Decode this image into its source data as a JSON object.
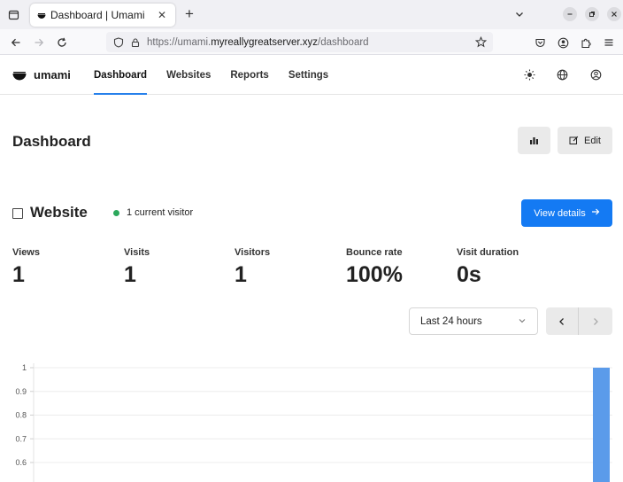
{
  "browser": {
    "tab_title": "Dashboard | Umami",
    "url_scheme": "https://umami.",
    "url_host": "myreallygreatserver.xyz",
    "url_path": "/dashboard"
  },
  "app": {
    "brand": "umami",
    "nav": [
      {
        "label": "Dashboard",
        "active": true
      },
      {
        "label": "Websites",
        "active": false
      },
      {
        "label": "Reports",
        "active": false
      },
      {
        "label": "Settings",
        "active": false
      }
    ]
  },
  "page": {
    "title": "Dashboard",
    "edit_label": "Edit"
  },
  "website": {
    "name": "Website",
    "live_text": "1 current visitor",
    "view_details_label": "View details",
    "metrics": [
      {
        "label": "Views",
        "value": "1"
      },
      {
        "label": "Visits",
        "value": "1"
      },
      {
        "label": "Visitors",
        "value": "1"
      },
      {
        "label": "Bounce rate",
        "value": "100%"
      },
      {
        "label": "Visit duration",
        "value": "0s"
      }
    ],
    "date_range": "Last 24 hours"
  },
  "colors": {
    "accent": "#147af3",
    "bar": "#5b9bea",
    "live": "#2ca85c"
  },
  "chart_data": {
    "type": "bar",
    "y_ticks": [
      "1",
      "0.9",
      "0.8",
      "0.7",
      "0.6"
    ],
    "y_visible_range": [
      0.55,
      1
    ],
    "bars": [
      {
        "slot": 25,
        "value": 1
      }
    ],
    "slots": 26
  }
}
